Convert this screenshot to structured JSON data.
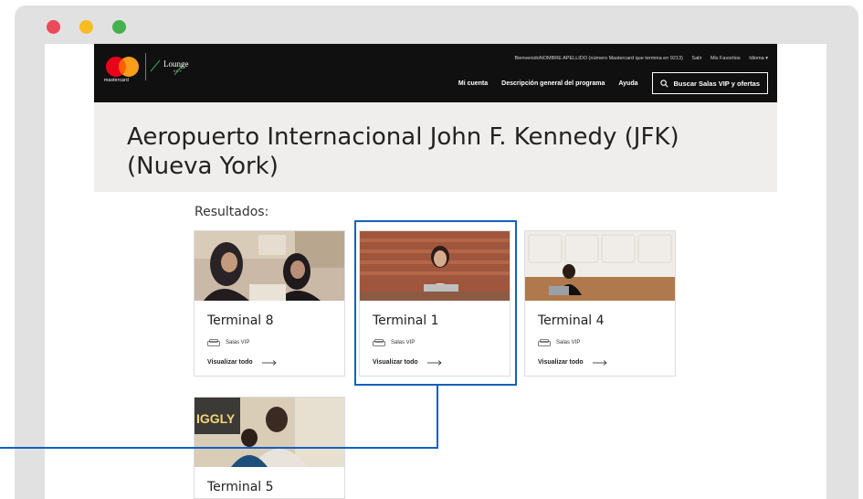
{
  "window": {
    "controls": [
      "close",
      "minimize",
      "maximize"
    ]
  },
  "header": {
    "brand": "mastercard",
    "lounge_logo_text": "Lounge",
    "lounge_logo_sub": "KEY",
    "welcome_text": "BienvenidoNOMBRE APELLIDO (número Mastercard que termina en 9213)",
    "top_links": [
      "Salir",
      "Mis Favoritos",
      "Idioma ▾"
    ],
    "nav": [
      "Mi cuenta",
      "Descripción general del programa",
      "Ayuda"
    ],
    "search_label": "Buscar Salas VIP y ofertas"
  },
  "hero": {
    "title": "Aeropuerto Internacional John F. Kennedy (JFK) (Nueva York)"
  },
  "results": {
    "label": "Resultados:",
    "cards": [
      {
        "title": "Terminal 8",
        "type": "Salas VIP",
        "link": "Visualizar todo"
      },
      {
        "title": "Terminal 1",
        "type": "Salas VIP",
        "link": "Visualizar todo"
      },
      {
        "title": "Terminal 4",
        "type": "Salas VIP",
        "link": "Visualizar todo"
      },
      {
        "title": "Terminal 5"
      }
    ]
  },
  "colors": {
    "header_bg": "#101010",
    "hero_bg": "#f0eeec",
    "highlight": "#1460c0",
    "mc_red": "#eb001b",
    "mc_orange": "#f79e1b"
  }
}
